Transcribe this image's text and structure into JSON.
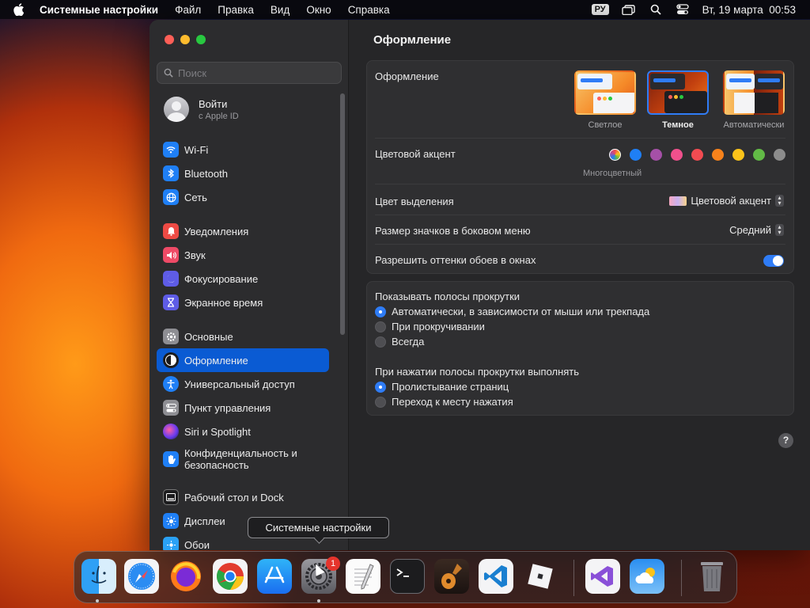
{
  "menubar": {
    "app_name": "Системные настройки",
    "items": [
      "Файл",
      "Правка",
      "Вид",
      "Окно",
      "Справка"
    ],
    "keyboard_layout": "РУ",
    "datetime": "Вт, 19 марта  00:53"
  },
  "sidebar": {
    "search_placeholder": "Поиск",
    "account": {
      "title": "Войти",
      "subtitle": "с Apple ID"
    },
    "items": [
      {
        "label": "Wi-Fi",
        "icon": "wifi-icon",
        "color": "#1f7ff5"
      },
      {
        "label": "Bluetooth",
        "icon": "bluetooth-icon",
        "color": "#1f7ff5"
      },
      {
        "label": "Сеть",
        "icon": "globe-icon",
        "color": "#1f7ff5"
      },
      {
        "label": "Уведомления",
        "icon": "bell-icon",
        "color": "#ee4a44"
      },
      {
        "label": "Звук",
        "icon": "speaker-icon",
        "color": "#ee4a66"
      },
      {
        "label": "Фокусирование",
        "icon": "moon-icon",
        "color": "#5e5ce6"
      },
      {
        "label": "Экранное время",
        "icon": "hourglass-icon",
        "color": "#5e5ce6"
      },
      {
        "label": "Основные",
        "icon": "gear-icon",
        "color": "#8e8e93"
      },
      {
        "label": "Оформление",
        "icon": "appearance-icon",
        "color": "#1c1c1e"
      },
      {
        "label": "Универсальный доступ",
        "icon": "accessibility-icon",
        "color": "#1f7ff5"
      },
      {
        "label": "Пункт управления",
        "icon": "control-center-icon",
        "color": "#8e8e93"
      },
      {
        "label": "Siri и Spotlight",
        "icon": "siri-icon",
        "color": "#3a3a7a"
      },
      {
        "label": "Конфиденциальность и безопасность",
        "icon": "hand-icon",
        "color": "#1f7ff5"
      },
      {
        "label": "Рабочий стол и Dock",
        "icon": "desktop-dock-icon",
        "color": "#1c1c1e"
      },
      {
        "label": "Дисплеи",
        "icon": "sun-icon",
        "color": "#1f7ff5"
      },
      {
        "label": "Обои",
        "icon": "wallpaper-icon",
        "color": "#2aa1f5"
      }
    ],
    "active_index": 8
  },
  "main": {
    "title": "Оформление",
    "appearance": {
      "label": "Оформление",
      "options": [
        "Светлое",
        "Темное",
        "Автоматически"
      ],
      "selected": "Темное"
    },
    "accent": {
      "label": "Цветовой акцент",
      "caption": "Многоцветный",
      "colors": [
        "multicolor",
        "#1f7ff5",
        "#a550a7",
        "#f0508c",
        "#f24b51",
        "#f7821b",
        "#fbc31a",
        "#62ba46",
        "#8c8c8c"
      ]
    },
    "highlight": {
      "label": "Цвет выделения",
      "value": "Цветовой акцент"
    },
    "sidebar_icon_size": {
      "label": "Размер значков в боковом меню",
      "value": "Средний"
    },
    "wallpaper_tinting": {
      "label": "Разрешить оттенки обоев в окнах",
      "enabled": true
    },
    "scrollbars": {
      "label": "Показывать полосы прокрутки",
      "options": [
        "Автоматически, в зависимости от мыши или трекпада",
        "При прокручивании",
        "Всегда"
      ],
      "selected_index": 0
    },
    "click_scrollbar": {
      "label": "При нажатии полосы прокрутки выполнять",
      "options": [
        "Пролистывание страниц",
        "Переход к месту нажатия"
      ],
      "selected_index": 0
    },
    "help": "?"
  },
  "tooltip": "Системные настройки",
  "dock": {
    "apps": [
      "finder-icon",
      "safari-icon",
      "firefox-icon",
      "chrome-icon",
      "app-store-icon",
      "system-settings-icon",
      "textedit-icon",
      "terminal-icon",
      "garageband-icon",
      "vscode-icon",
      "roblox-icon",
      "visual-studio-icon",
      "weather-icon",
      "trash-icon"
    ],
    "badge": "1"
  }
}
